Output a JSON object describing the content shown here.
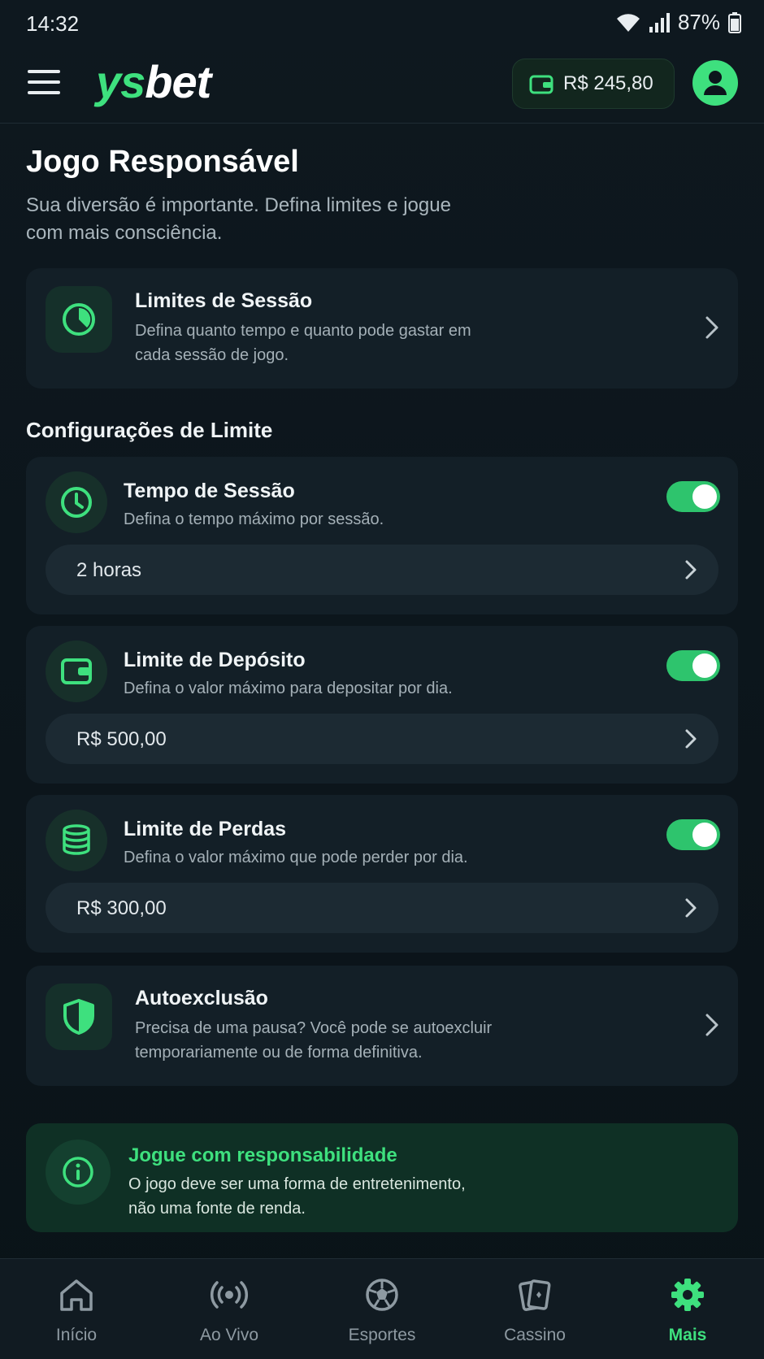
{
  "status_bar": {
    "time": "14:32",
    "battery": "87%"
  },
  "header": {
    "logo_part1": "ys",
    "logo_part2": "bet",
    "balance": "R$ 245,80"
  },
  "page": {
    "title": "Jogo Responsável",
    "subtitle": "Sua diversão é importante. Defina limites e jogue com mais consciência."
  },
  "session_limits": {
    "title": "Limites de Sessão",
    "description": "Defina quanto tempo e quanto pode gastar em cada sessão de jogo."
  },
  "limit_settings": {
    "heading": "Configurações de Limite",
    "items": [
      {
        "title": "Tempo de Sessão",
        "description": "Defina o tempo máximo por sessão.",
        "value": "2 horas",
        "enabled": true
      },
      {
        "title": "Limite de Depósito",
        "description": "Defina o valor máximo para depositar por dia.",
        "value": "R$ 500,00",
        "enabled": true
      },
      {
        "title": "Limite de Perdas",
        "description": "Defina o valor máximo que pode perder por dia.",
        "value": "R$ 300,00",
        "enabled": true
      }
    ]
  },
  "self_exclusion": {
    "title": "Autoexclusão",
    "description": "Precisa de uma pausa? Você pode se autoexcluir temporariamente ou de forma definitiva."
  },
  "info": {
    "title": "Jogue com responsabilidade",
    "description": "O jogo deve ser uma forma de entretenimento, não uma fonte de renda."
  },
  "nav": [
    {
      "label": "Início",
      "icon": "home-icon",
      "active": false
    },
    {
      "label": "Ao Vivo",
      "icon": "live-icon",
      "active": false
    },
    {
      "label": "Esportes",
      "icon": "sports-ball-icon",
      "active": false
    },
    {
      "label": "Cassino",
      "icon": "cards-icon",
      "active": false
    },
    {
      "label": "Mais",
      "icon": "gear-icon",
      "active": true
    }
  ],
  "colors": {
    "accent": "#3ee07e",
    "background": "#0c151c",
    "card": "#131f27"
  }
}
